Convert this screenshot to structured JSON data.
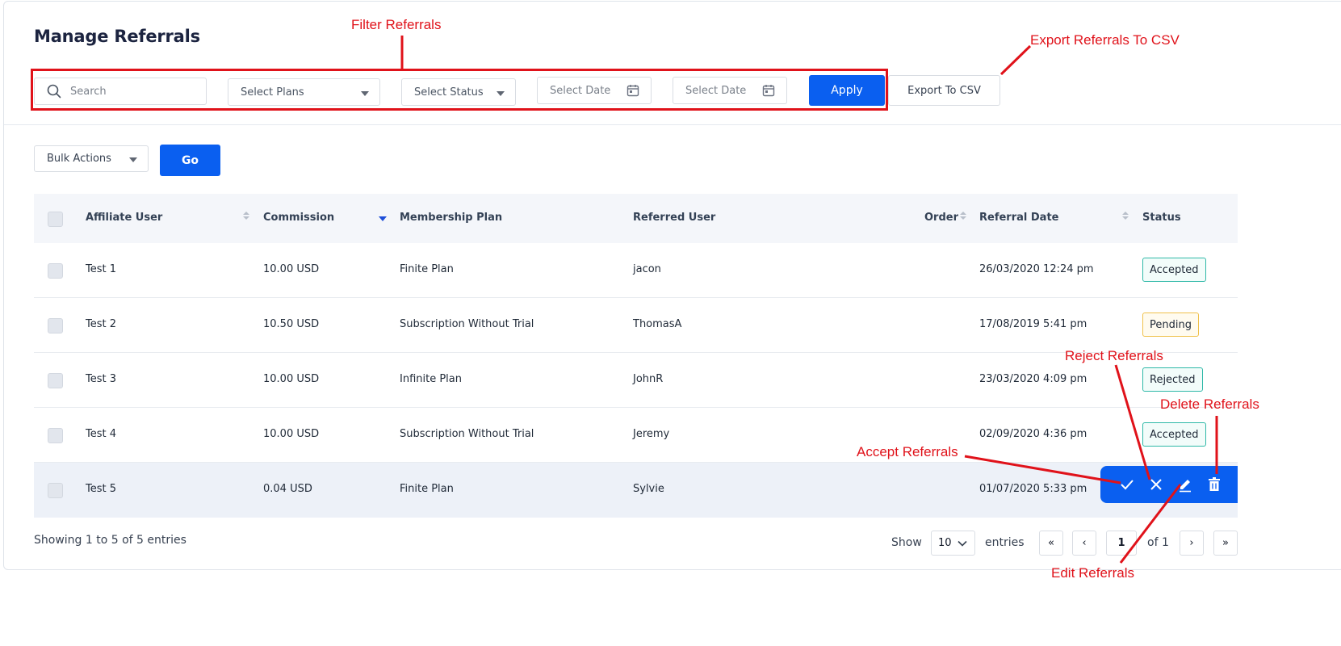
{
  "page": {
    "title": "Manage Referrals"
  },
  "filters": {
    "search_placeholder": "Search",
    "plans_label": "Select Plans",
    "status_label": "Select Status",
    "date_from_placeholder": "Select Date",
    "date_to_placeholder": "Select Date",
    "apply_label": "Apply",
    "export_label": "Export To CSV"
  },
  "bulk": {
    "label": "Bulk Actions",
    "go_label": "Go"
  },
  "table": {
    "columns": [
      "Affiliate User",
      "Commission",
      "Membership Plan",
      "Referred User",
      "Order",
      "Referral Date",
      "Status"
    ],
    "rows": [
      {
        "affiliate": "Test 1",
        "commission": "10.00 USD",
        "plan": "Finite Plan",
        "referred": "jacon",
        "date": "26/03/2020 12:24 pm",
        "status": "Accepted"
      },
      {
        "affiliate": "Test 2",
        "commission": "10.50 USD",
        "plan": "Subscription Without Trial",
        "referred": "ThomasA",
        "date": "17/08/2019 5:41 pm",
        "status": "Pending"
      },
      {
        "affiliate": "Test 3",
        "commission": "10.00 USD",
        "plan": "Infinite Plan",
        "referred": "JohnR",
        "date": "23/03/2020 4:09 pm",
        "status": "Rejected"
      },
      {
        "affiliate": "Test 4",
        "commission": "10.00 USD",
        "plan": "Subscription Without Trial",
        "referred": "Jeremy",
        "date": "02/09/2020 4:36 pm",
        "status": "Accepted"
      },
      {
        "affiliate": "Test 5",
        "commission": "0.04 USD",
        "plan": "Finite Plan",
        "referred": "Sylvie",
        "date": "01/07/2020 5:33 pm",
        "status": ""
      }
    ]
  },
  "footer": {
    "showing": "Showing 1 to 5 of 5 entries",
    "show_label": "Show",
    "page_size": "10",
    "entries_label": "entries",
    "first": "«",
    "prev": "‹",
    "current_page": "1",
    "of_label": "of 1",
    "next": "›",
    "last": "»"
  },
  "annotations": {
    "filter": "Filter Referrals",
    "export": "Export Referrals To CSV",
    "reject": "Reject Referrals",
    "delete": "Delete Referrals",
    "accept": "Accept Referrals",
    "edit": "Edit Referrals"
  },
  "colors": {
    "accent": "#0a5ff0",
    "annotation": "#e0121a",
    "accepted": "#2fb9a8",
    "pending": "#f0c14b"
  },
  "icons": [
    "search-icon",
    "chevron-down-icon",
    "calendar-icon",
    "check-icon",
    "close-icon",
    "edit-icon",
    "trash-icon",
    "sort-icon"
  ]
}
